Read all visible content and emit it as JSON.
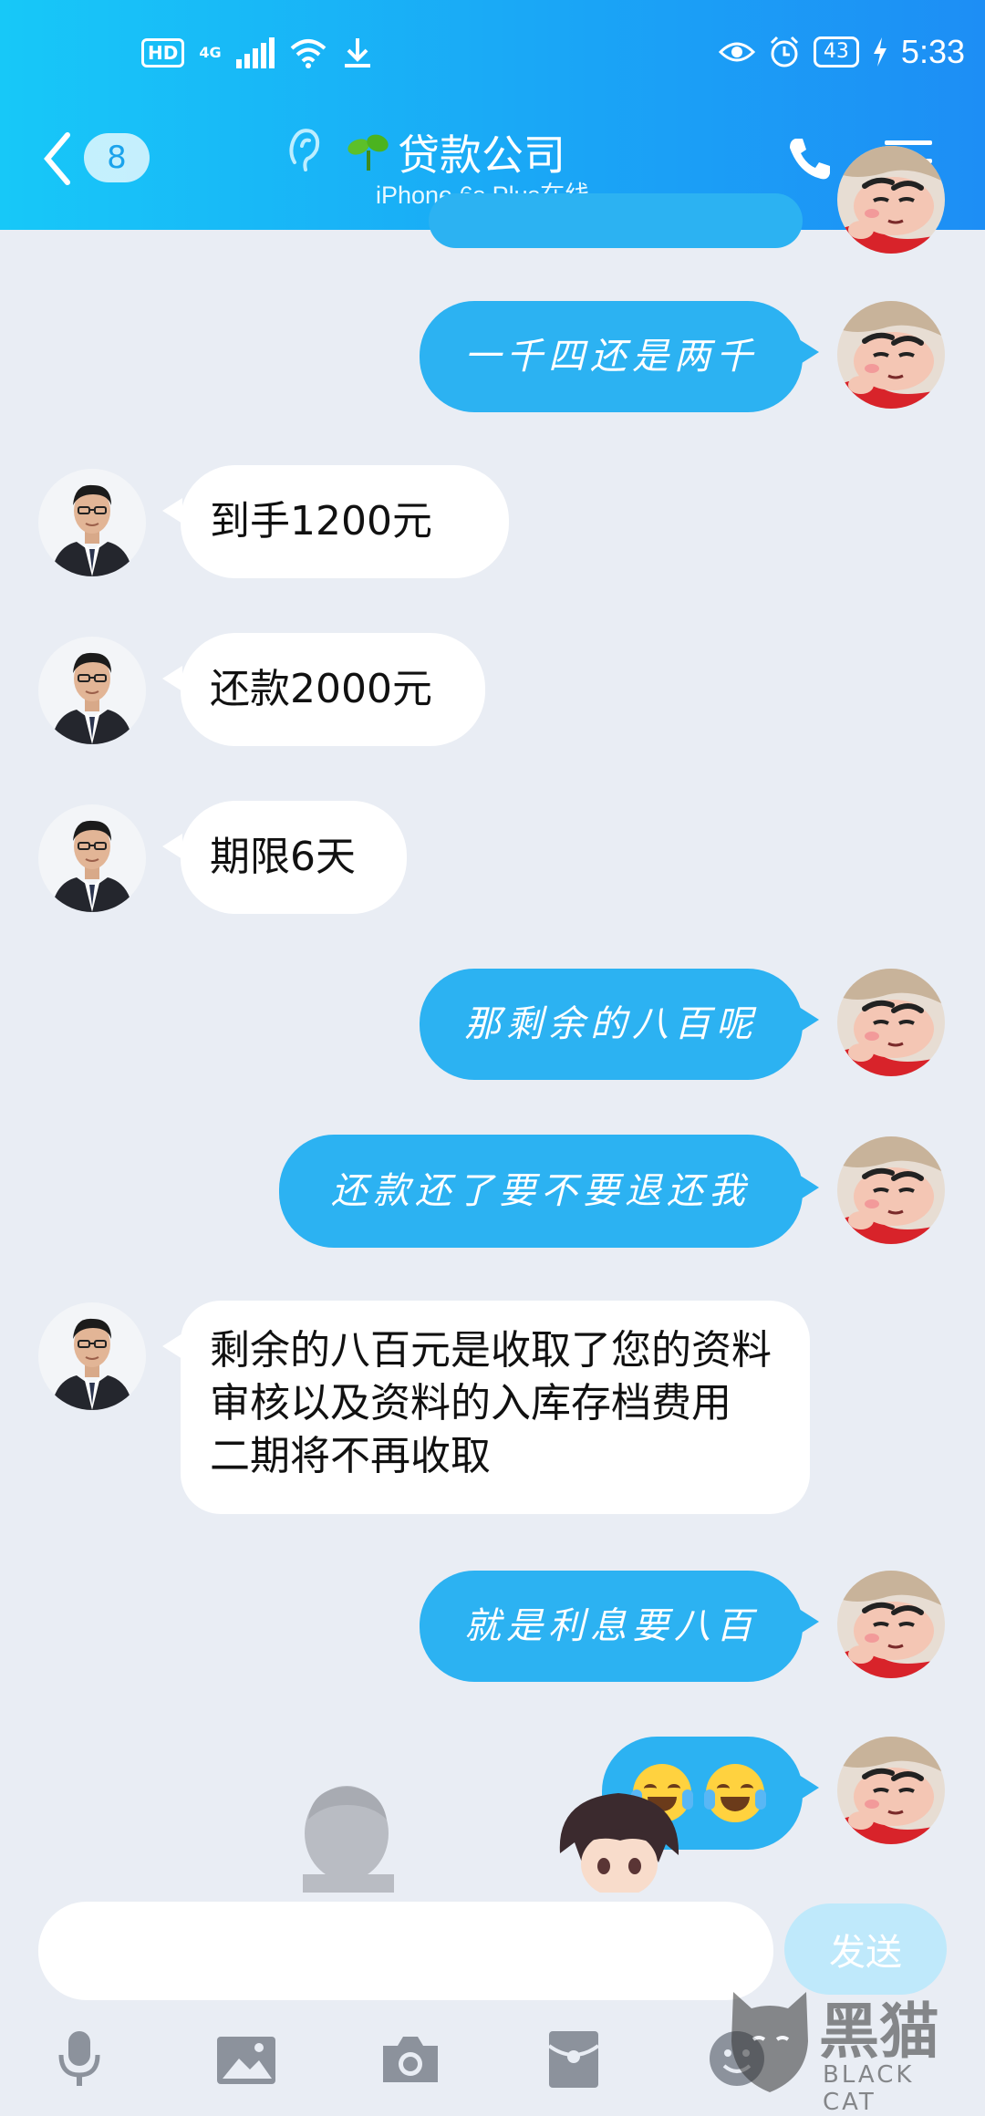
{
  "status_bar": {
    "hd": "HD",
    "network": "4G",
    "battery": "43",
    "time": "5:33"
  },
  "header": {
    "unread_count": "8",
    "title": "贷款公司",
    "subtitle": "iPhone 6s Plus在线"
  },
  "messages": [
    {
      "side": "right",
      "text": "一千四还是两千"
    },
    {
      "side": "left",
      "text": "到手1200元"
    },
    {
      "side": "left",
      "text": "还款2000元"
    },
    {
      "side": "left",
      "text": "期限6天"
    },
    {
      "side": "right",
      "text": "那剩余的八百呢"
    },
    {
      "side": "right",
      "text": "还款还了要不要退还我"
    },
    {
      "side": "left",
      "text": "剩余的八百元是收取了您的资料审核以及资料的入库存档费用  二期将不再收取"
    },
    {
      "side": "right",
      "text": "就是利息要八百"
    },
    {
      "side": "right",
      "emoji": [
        "face-with-tears-of-joy",
        "face-with-tears-of-joy"
      ]
    }
  ],
  "input": {
    "placeholder": "",
    "send_label": "发送"
  },
  "toolbar": [
    "microphone-icon",
    "image-icon",
    "camera-icon",
    "red-packet-icon",
    "emoji-icon"
  ],
  "watermark": {
    "text": "黑猫",
    "sub": "BLACK CAT"
  },
  "colors": {
    "header": "#1aa7f6",
    "my_bubble": "#2cb2f2",
    "their_bubble": "#ffffff",
    "background": "#e9edf4"
  }
}
